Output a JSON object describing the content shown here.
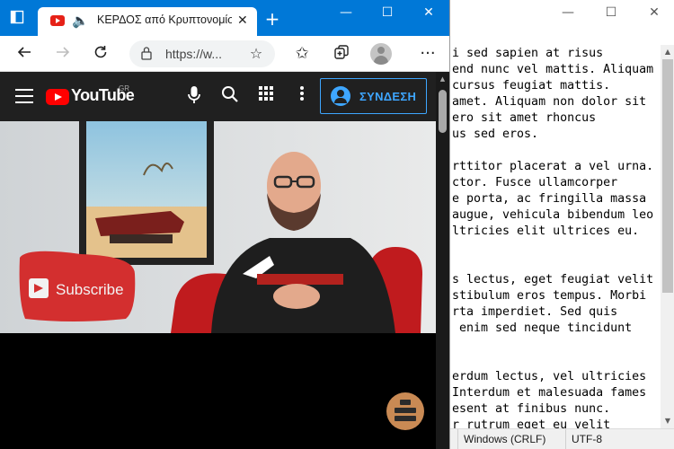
{
  "notepad": {
    "window_controls": {
      "minimize": "—",
      "maximize": "☐",
      "close": "✕"
    },
    "lines": [
      "i sed sapien at risus",
      "end nunc vel mattis. Aliquam",
      "cursus feugiat mattis.",
      "amet. Aliquam non dolor sit",
      "ero sit amet rhoncus",
      "us sed eros.",
      "",
      "rttitor placerat a vel urna.",
      "ctor. Fusce ullamcorper",
      "e porta, ac fringilla massa",
      "augue, vehicula bibendum leo",
      "ltricies elit ultrices eu.",
      "",
      "",
      "s lectus, eget feugiat velit",
      "stibulum eros tempus. Morbi",
      "rta imperdiet. Sed quis",
      " enim sed neque tincidunt",
      "",
      "",
      "erdum lectus, vel ultricies",
      "Interdum et malesuada fames",
      "esent at finibus nunc.",
      "r rutrum eget eu velit"
    ],
    "status": {
      "line_ending": "Windows (CRLF)",
      "encoding": "UTF-8"
    }
  },
  "browser": {
    "tab": {
      "title": "ΚΕΡΔΟΣ από Κρυπτονομίσματα",
      "audio_icon": "speaker-icon",
      "close": "✕"
    },
    "new_tab": "+",
    "window_controls": {
      "minimize": "—",
      "maximize": "☐",
      "close": "✕"
    },
    "address": {
      "url": "https://w..."
    },
    "youtube": {
      "logo_text": "YouTube",
      "region": "GR",
      "sign_in": "ΣΥΝΔΕΣΗ"
    },
    "video": {
      "subscribe_pillow": "Subscribe"
    }
  }
}
